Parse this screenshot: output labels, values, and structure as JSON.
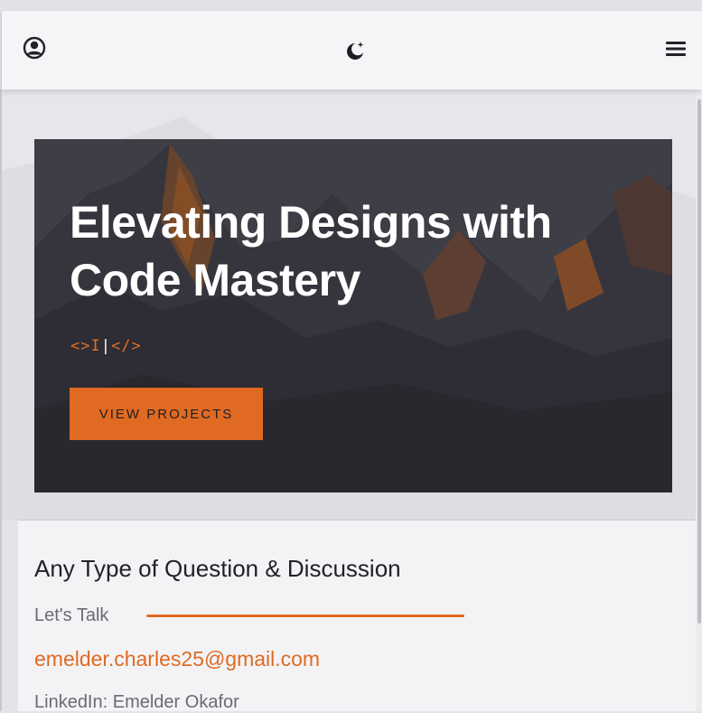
{
  "header": {
    "icons": {
      "user": "user-circle-icon",
      "theme": "moon-star-icon",
      "menu": "hamburger-menu-icon"
    }
  },
  "hero": {
    "title": "Elevating Designs with Code Mastery",
    "code_tag_left": "<>I",
    "code_tag_cursor": "|",
    "code_tag_right": "</>",
    "button_label": "VIEW PROJECTS"
  },
  "contact": {
    "title": "Any Type of Question & Discussion",
    "lets_talk": "Let's Talk",
    "email": "emelder.charles25@gmail.com",
    "linkedin": "LinkedIn: Emelder Okafor"
  },
  "colors": {
    "accent": "#e06a22",
    "header_bg": "#f5f5f7",
    "page_bg": "#e4e4e8",
    "text_dark": "#222226",
    "text_muted": "#6b6b70"
  }
}
